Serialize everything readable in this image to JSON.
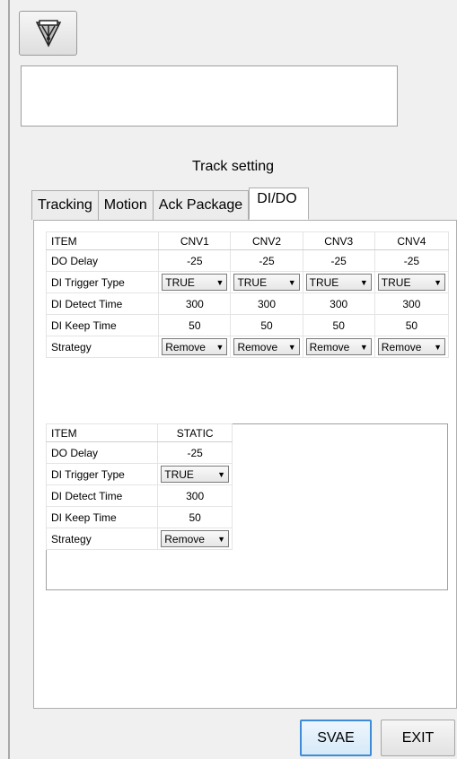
{
  "header": {
    "logo_icon": "robot-arm-icon"
  },
  "message_box": {
    "value": ""
  },
  "title": "Track setting",
  "tabs": [
    {
      "label": "Tracking",
      "active": false
    },
    {
      "label": "Motion",
      "active": false
    },
    {
      "label": "Ack Package",
      "active": false
    },
    {
      "label": "DI/DO",
      "active": true
    }
  ],
  "conveyor_table": {
    "item_header": "ITEM",
    "columns": [
      "CNV1",
      "CNV2",
      "CNV3",
      "CNV4"
    ],
    "rows": {
      "do_delay": {
        "label": "DO Delay",
        "values": [
          "-25",
          "-25",
          "-25",
          "-25"
        ]
      },
      "di_trigger_type": {
        "label": "DI Trigger Type",
        "values": [
          "TRUE",
          "TRUE",
          "TRUE",
          "TRUE"
        ]
      },
      "di_detect_time": {
        "label": "DI Detect Time",
        "values": [
          "300",
          "300",
          "300",
          "300"
        ]
      },
      "di_keep_time": {
        "label": "DI Keep Time",
        "values": [
          "50",
          "50",
          "50",
          "50"
        ]
      },
      "strategy": {
        "label": "Strategy",
        "values": [
          "Remove",
          "Remove",
          "Remove",
          "Remove"
        ]
      }
    }
  },
  "static_table": {
    "item_header": "ITEM",
    "column": "STATIC",
    "rows": {
      "do_delay": {
        "label": "DO Delay",
        "value": "-25"
      },
      "di_trigger_type": {
        "label": "DI Trigger Type",
        "value": "TRUE"
      },
      "di_detect_time": {
        "label": "DI Detect Time",
        "value": "300"
      },
      "di_keep_time": {
        "label": "DI Keep Time",
        "value": "50"
      },
      "strategy": {
        "label": "Strategy",
        "value": "Remove"
      }
    }
  },
  "buttons": {
    "save": "SVAE",
    "exit": "EXIT"
  },
  "colors": {
    "save_border": "#3d8bd9",
    "panel_border": "#adadad"
  }
}
